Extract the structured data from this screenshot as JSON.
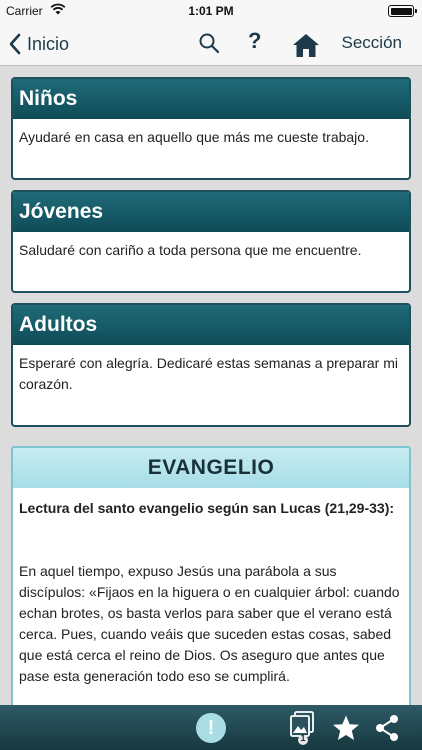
{
  "status_bar": {
    "carrier": "Carrier",
    "time": "1:01 PM"
  },
  "nav": {
    "back_label": "Inicio",
    "section_label": "Sección",
    "help_label": "?"
  },
  "cards": [
    {
      "title": "Niños",
      "text": "Ayudaré en casa en aquello que más me cueste trabajo."
    },
    {
      "title": "Jóvenes",
      "text": "Saludaré con cariño a toda persona que me encuentre."
    },
    {
      "title": "Adultos",
      "text": "Esperaré con alegría. Dedicaré estas semanas a preparar mi corazón."
    }
  ],
  "gospel": {
    "title": "EVANGELIO",
    "reading": "Lectura del santo evangelio según san Lucas (21,29-33):",
    "text": "En aquel tiempo, expuso Jesús una parábola a sus discípulos: «Fijaos en la higuera o en cualquier árbol: cuando echan brotes, os basta verlos para saber que el verano está cerca. Pues, cuando veáis que suceden estas cosas, sabed que está cerca el reino de Dios. Os aseguro que antes que pase esta generación todo eso se cumplirá."
  },
  "toolbar": {
    "alert_label": "!",
    "gallery_count": "1"
  },
  "colors": {
    "card_header": "#1f6b79",
    "gospel_header": "#a7dde7",
    "toolbar": "#17383f",
    "nav_text": "#1c3a4a"
  }
}
